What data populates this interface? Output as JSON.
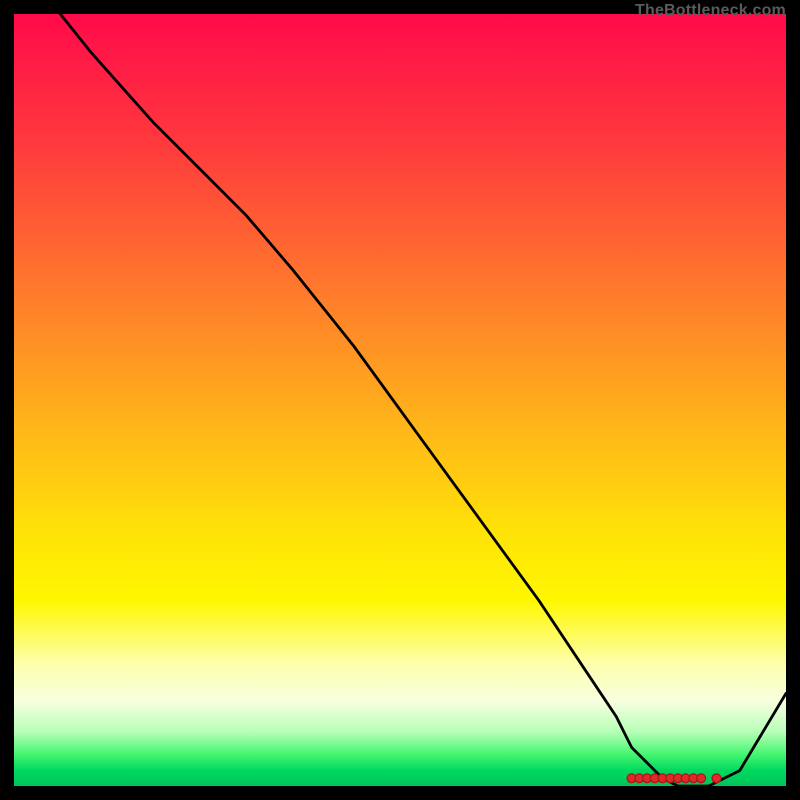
{
  "attribution": "TheBottleneck.com",
  "colors": {
    "page_bg": "#000000",
    "line": "#000000",
    "marker_fill": "#e02a2a",
    "marker_stroke": "#b01616",
    "attribution_text": "#5b5b5b"
  },
  "chart_data": {
    "type": "line",
    "title": "",
    "xlabel": "",
    "ylabel": "",
    "xlim": [
      0,
      100
    ],
    "ylim": [
      0,
      100
    ],
    "grid": false,
    "legend": false,
    "series": [
      {
        "name": "curve",
        "x": [
          6,
          10,
          18,
          25,
          30,
          36,
          44,
          52,
          60,
          68,
          74,
          78,
          80,
          82,
          84,
          86,
          88,
          90,
          92,
          94,
          100
        ],
        "y": [
          100,
          95,
          86,
          79,
          74,
          67,
          57,
          46,
          35,
          24,
          15,
          9,
          5,
          3,
          1,
          0,
          0,
          0,
          1,
          2,
          12
        ]
      }
    ],
    "markers": {
      "name": "highlight",
      "x": [
        80,
        81,
        82,
        83,
        84,
        85,
        86,
        87,
        88,
        89,
        91
      ],
      "y": [
        1,
        1,
        1,
        1,
        1,
        1,
        1,
        1,
        1,
        1,
        1
      ]
    }
  }
}
